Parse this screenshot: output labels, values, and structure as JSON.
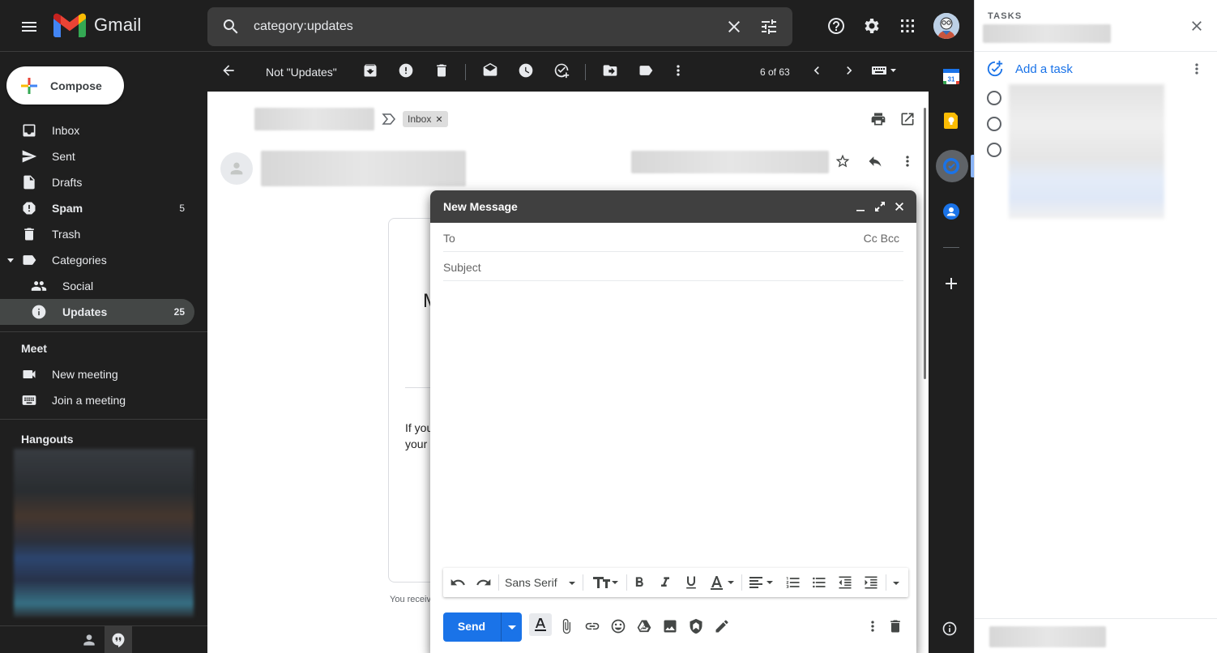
{
  "app": {
    "name": "Gmail"
  },
  "search": {
    "query": "category:updates"
  },
  "sidebar": {
    "compose_label": "Compose",
    "items": [
      {
        "label": "Inbox",
        "count": ""
      },
      {
        "label": "Sent",
        "count": ""
      },
      {
        "label": "Drafts",
        "count": ""
      },
      {
        "label": "Spam",
        "count": "5"
      },
      {
        "label": "Trash",
        "count": ""
      },
      {
        "label": "Categories",
        "count": ""
      },
      {
        "label": "Social",
        "count": ""
      },
      {
        "label": "Updates",
        "count": "25"
      }
    ],
    "meet": {
      "title": "Meet",
      "new_meeting": "New meeting",
      "join_meeting": "Join a meeting"
    },
    "hangouts": {
      "title": "Hangouts"
    }
  },
  "mail_toolbar": {
    "not_updates_label": "Not \"Updates\"",
    "page_count": "6 of 63"
  },
  "mail_view": {
    "label_chip": "Inbox",
    "body_heading_fragment": "M",
    "body_line1": "If you",
    "body_line2": "your",
    "footer_text": "You receiv"
  },
  "compose_window": {
    "title": "New Message",
    "to_label": "To",
    "cc_bcc_label": "Cc Bcc",
    "subject_placeholder": "Subject",
    "font_name": "Sans Serif",
    "send_label": "Send"
  },
  "tasks": {
    "title": "TASKS",
    "add_task_label": "Add a task"
  },
  "colors": {
    "accent_blue": "#1a73e8",
    "dark_bg": "#1f1f1f",
    "active_nav": "#444746"
  }
}
